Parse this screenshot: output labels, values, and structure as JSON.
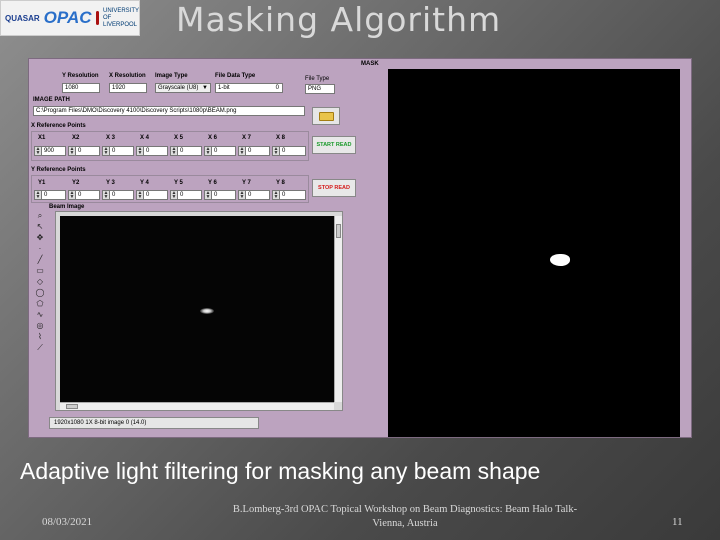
{
  "header": {
    "title": "Masking Algorithm",
    "logos": {
      "quasar": "QUASAR",
      "opac": "OPAC",
      "liverpool": "UNIVERSITY OF LIVERPOOL"
    }
  },
  "app": {
    "y_resolution": {
      "label": "Y Resolution",
      "value": "1080"
    },
    "x_resolution": {
      "label": "X Resolution",
      "value": "1920"
    },
    "image_type": {
      "label": "Image Type",
      "value": "Grayscale (U8)"
    },
    "file_data_type": {
      "label": "File Data Type",
      "value": "1-bit",
      "index": "0"
    },
    "file_type": {
      "label": "File Type",
      "value": "PNG"
    },
    "image_path": {
      "label": "IMAGE PATH",
      "value": "C:\\Program Files\\DMO\\Discovery 4100\\Discovery Scripts\\1080p\\BEAM.png"
    },
    "x_ref": {
      "label": "X Reference Points",
      "items": [
        {
          "label": "X1",
          "value": "900"
        },
        {
          "label": "X2",
          "value": "0"
        },
        {
          "label": "X 3",
          "value": "0"
        },
        {
          "label": "X 4",
          "value": "0"
        },
        {
          "label": "X 5",
          "value": "0"
        },
        {
          "label": "X 6",
          "value": "0"
        },
        {
          "label": "X 7",
          "value": "0"
        },
        {
          "label": "X 8",
          "value": "0"
        }
      ]
    },
    "y_ref": {
      "label": "Y Reference Points",
      "items": [
        {
          "label": "Y1",
          "value": "0"
        },
        {
          "label": "Y2",
          "value": "0"
        },
        {
          "label": "Y 3",
          "value": "0"
        },
        {
          "label": "Y 4",
          "value": "0"
        },
        {
          "label": "Y 5",
          "value": "0"
        },
        {
          "label": "Y 6",
          "value": "0"
        },
        {
          "label": "Y 7",
          "value": "0"
        },
        {
          "label": "Y 8",
          "value": "0"
        }
      ]
    },
    "start_button": "START READ",
    "stop_button": "STOP READ",
    "beam_label": "Beam Image",
    "status": "1920x1080 1X 8-bit image 0   (14.0)",
    "mask_label": "MASK",
    "colors": {
      "start": "#1a9a2a",
      "stop": "#d41a1a",
      "panel": "#bca3bf"
    }
  },
  "caption": "Adaptive light filtering for masking any beam shape",
  "footer": {
    "date": "08/03/2021",
    "center": "B.Lomberg-3rd OPAC Topical Workshop on Beam Diagnostics: Beam Halo Talk- Vienna, Austria",
    "page": "11"
  }
}
